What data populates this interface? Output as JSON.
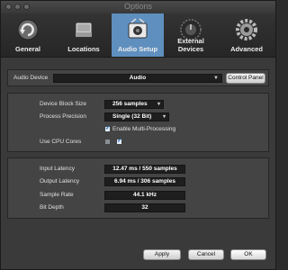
{
  "window": {
    "title": "Options"
  },
  "tabs": [
    {
      "label": "General",
      "icon": "refresh-icon"
    },
    {
      "label": "Locations",
      "icon": "folder-icon"
    },
    {
      "label": "Audio Setup",
      "icon": "audio-setup-icon",
      "active": true
    },
    {
      "label": "External Devices",
      "icon": "knob-icon"
    },
    {
      "label": "Advanced",
      "icon": "gear-icon"
    }
  ],
  "audio_device": {
    "label": "Audio Device",
    "value": "Audio",
    "control_panel_label": "Control Panel"
  },
  "settings": {
    "block_size": {
      "label": "Device Block Size",
      "value": "256 samples"
    },
    "precision": {
      "label": "Process Precision",
      "value": "Single (32 Bit)"
    },
    "multiprocessing": {
      "label": "Enable Multi-Processing",
      "checked": true
    },
    "cpu_cores": {
      "label": "Use CPU Cores",
      "checked": [
        false,
        true
      ]
    }
  },
  "info": {
    "input_latency": {
      "label": "Input Latency",
      "value": "12.47 ms / 550 samples"
    },
    "output_latency": {
      "label": "Output Latency",
      "value": "6.94 ms / 306 samples"
    },
    "sample_rate": {
      "label": "Sample Rate",
      "value": "44.1 kHz"
    },
    "bit_depth": {
      "label": "Bit Depth",
      "value": "32"
    }
  },
  "buttons": {
    "apply": "Apply",
    "cancel": "Cancel",
    "ok": "OK"
  },
  "colors": {
    "accent": "#5f8fbe",
    "background": "#3a3a3a",
    "panel": "#444444"
  }
}
